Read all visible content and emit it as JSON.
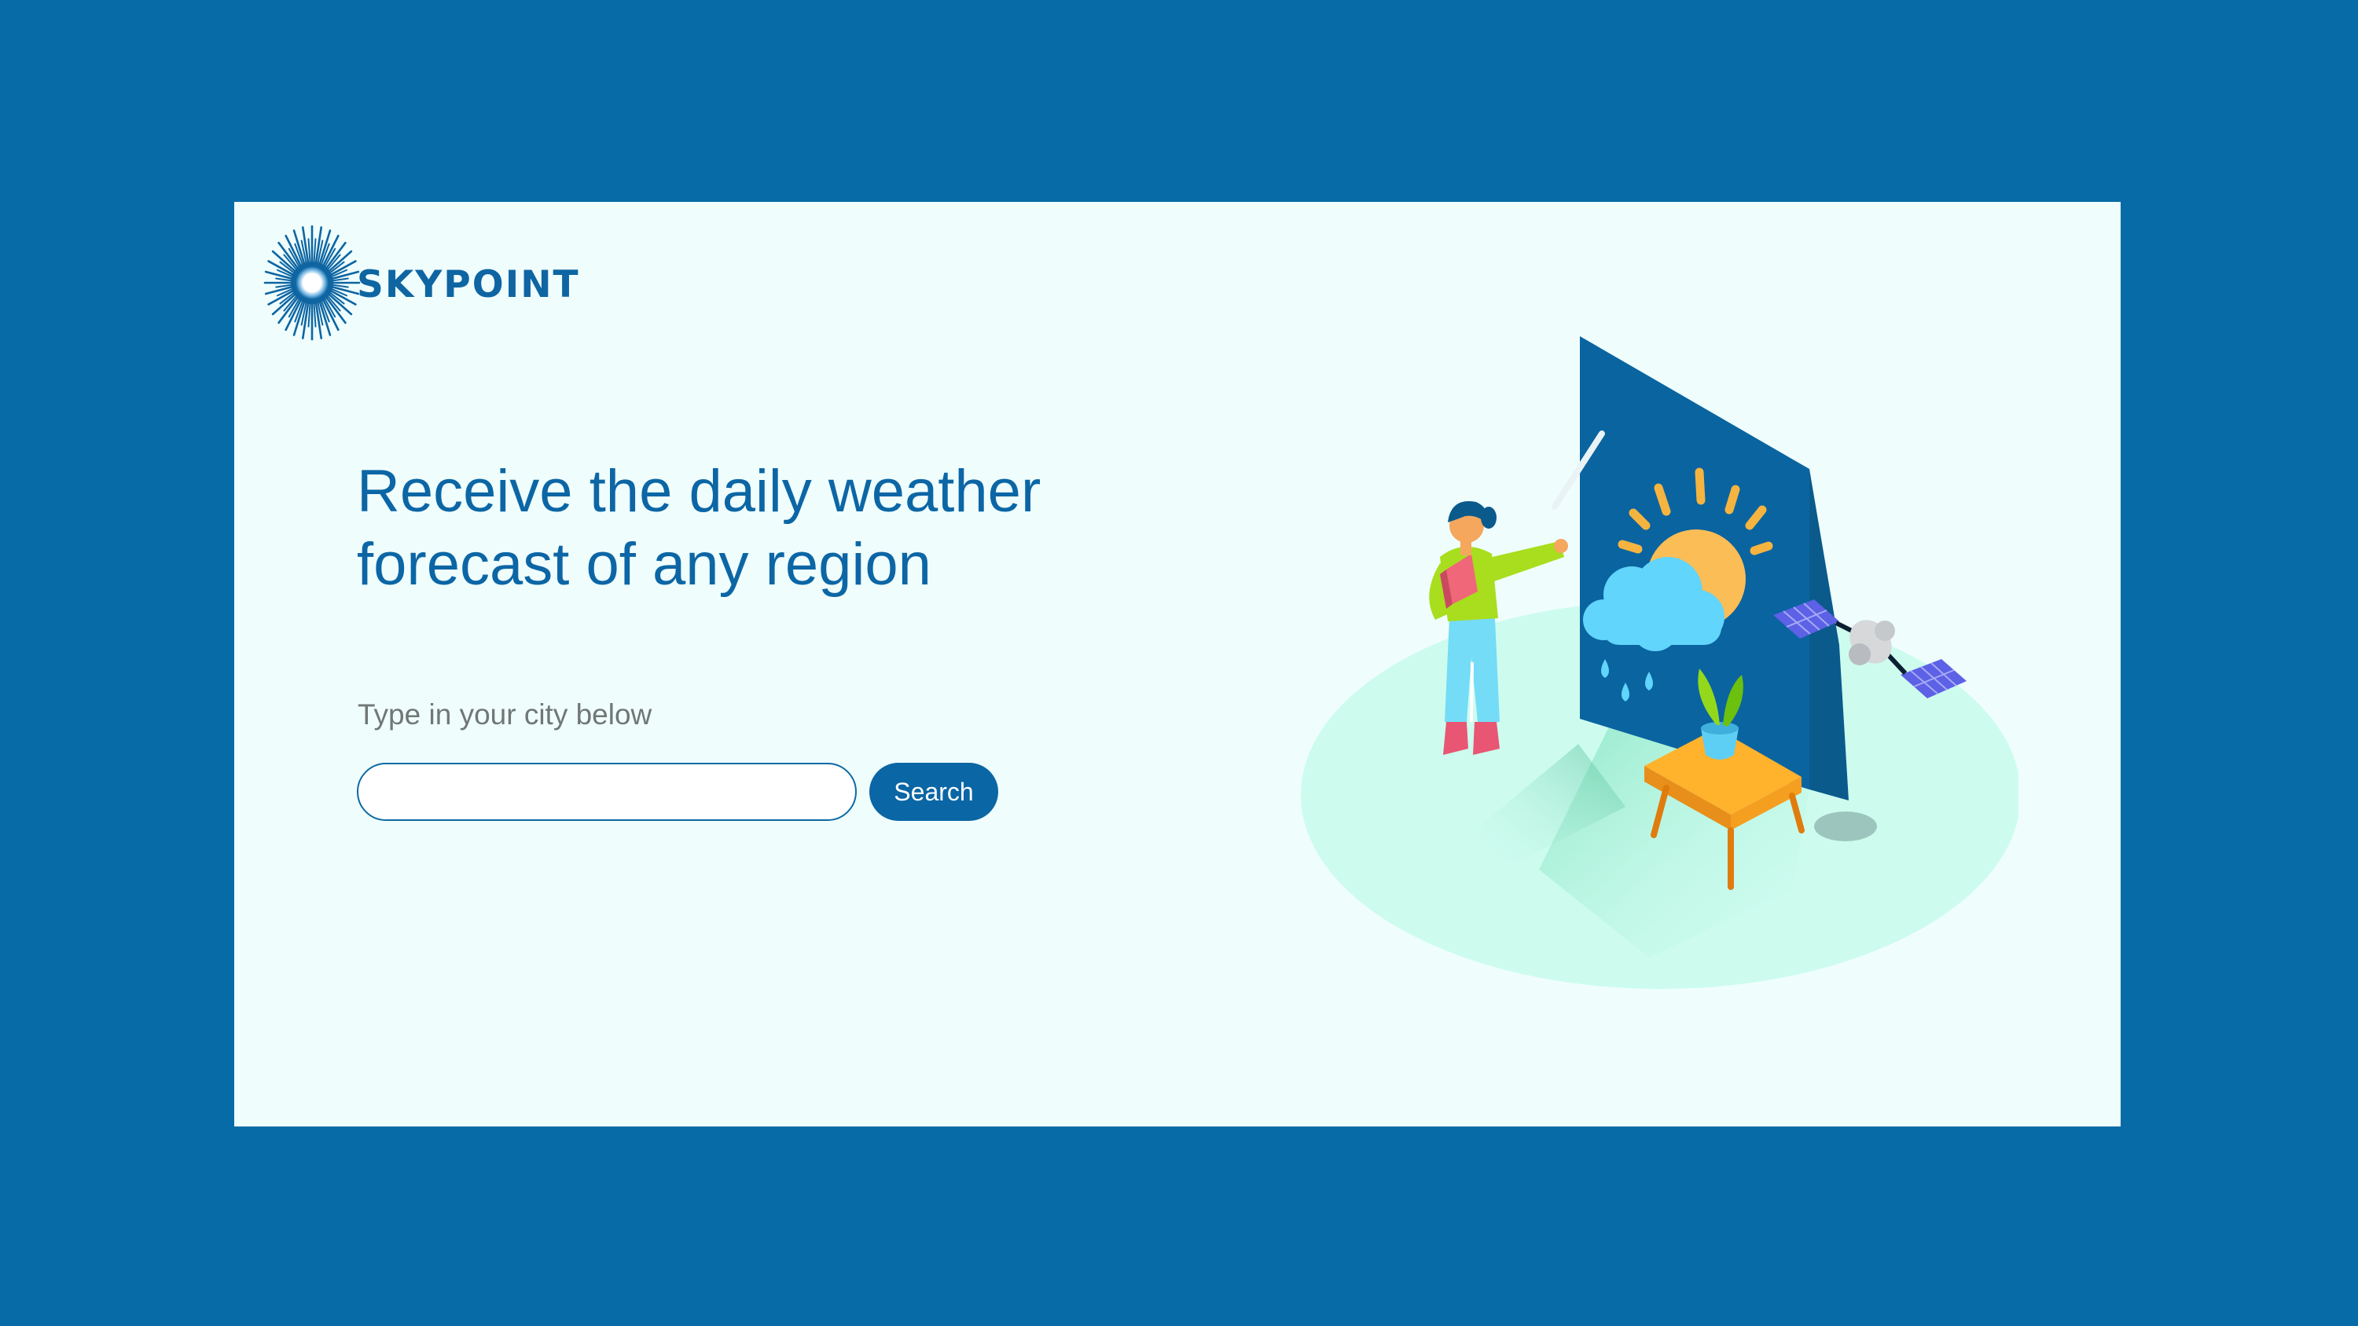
{
  "brand": {
    "name": "SKYPOINT",
    "logo_icon": "starburst-icon",
    "primary_color": "#066ba6",
    "background_color": "#effefd"
  },
  "hero": {
    "headline_line1": "Receive the daily weather",
    "headline_line2": "forecast of any region",
    "prompt": "Type in your city below"
  },
  "search": {
    "value": "",
    "placeholder": "",
    "button_label": "Search"
  }
}
